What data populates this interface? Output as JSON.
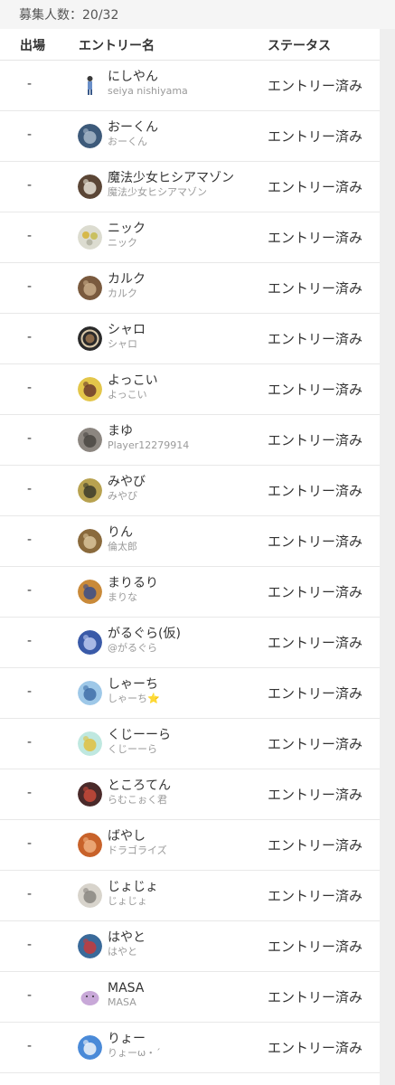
{
  "recruit": {
    "label": "募集人数：20/32"
  },
  "table": {
    "headers": {
      "appear": "出場",
      "name": "エントリー名",
      "status": "ステータス"
    },
    "rows": [
      {
        "appear": "-",
        "name": "にしやん",
        "sub": "seiya nishiyama",
        "status": "エントリー済み",
        "avatar": {
          "type": "figure",
          "bg": "#ffffff",
          "fg": "#6a8fc9"
        }
      },
      {
        "appear": "-",
        "name": "おーくん",
        "sub": "おーくん",
        "status": "エントリー済み",
        "avatar": {
          "type": "circle",
          "bg": "#3d5a7a",
          "fg": "#a7b8c9"
        }
      },
      {
        "appear": "-",
        "name": "魔法少女ヒシアマゾン",
        "sub": "魔法少女ヒシアマゾン",
        "status": "エントリー済み",
        "avatar": {
          "type": "circle",
          "bg": "#5b4636",
          "fg": "#e8e2d6"
        }
      },
      {
        "appear": "-",
        "name": "ニック",
        "sub": "ニック",
        "status": "エントリー済み",
        "avatar": {
          "type": "dots",
          "bg": "#dcdcd0",
          "fg": "#d6b84a"
        }
      },
      {
        "appear": "-",
        "name": "カルク",
        "sub": "カルク",
        "status": "エントリー済み",
        "avatar": {
          "type": "circle",
          "bg": "#7a5a3e",
          "fg": "#c9ad8a"
        }
      },
      {
        "appear": "-",
        "name": "シャロ",
        "sub": "シャロ",
        "status": "エントリー済み",
        "avatar": {
          "type": "ring",
          "bg": "#2a2a2a",
          "fg": "#d8c7a8"
        }
      },
      {
        "appear": "-",
        "name": "よっこい",
        "sub": "よっこい",
        "status": "エントリー済み",
        "avatar": {
          "type": "circle",
          "bg": "#e3c64a",
          "fg": "#6b3a2a"
        }
      },
      {
        "appear": "-",
        "name": "まゆ",
        "sub": "Player12279914",
        "status": "エントリー済み",
        "avatar": {
          "type": "circle",
          "bg": "#8c8680",
          "fg": "#4a4642"
        }
      },
      {
        "appear": "-",
        "name": "みやび",
        "sub": "みやび",
        "status": "エントリー済み",
        "avatar": {
          "type": "circle",
          "bg": "#b8a250",
          "fg": "#3b3b2a"
        }
      },
      {
        "appear": "-",
        "name": "りん",
        "sub": "倫太郎",
        "status": "エントリー済み",
        "avatar": {
          "type": "circle",
          "bg": "#8a6a3c",
          "fg": "#d8c39a"
        }
      },
      {
        "appear": "-",
        "name": "まりるり",
        "sub": "まりな",
        "status": "エントリー済み",
        "avatar": {
          "type": "circle",
          "bg": "#c98a3a",
          "fg": "#3a4d8a"
        }
      },
      {
        "appear": "-",
        "name": "がるぐら(仮)",
        "sub": "@がるぐら",
        "status": "エントリー済み",
        "avatar": {
          "type": "circle",
          "bg": "#3a5aa8",
          "fg": "#bcc9f0"
        }
      },
      {
        "appear": "-",
        "name": "しゃーち",
        "sub": "しゃーち⭐️",
        "status": "エントリー済み",
        "avatar": {
          "type": "circle",
          "bg": "#9ec8e8",
          "fg": "#3f6fa8"
        }
      },
      {
        "appear": "-",
        "name": "くじーーら",
        "sub": "くじーーら",
        "status": "エントリー済み",
        "avatar": {
          "type": "circle",
          "bg": "#bfe8e0",
          "fg": "#e0c040"
        }
      },
      {
        "appear": "-",
        "name": "ところてん",
        "sub": "らむこぉく君",
        "status": "エントリー済み",
        "avatar": {
          "type": "circle",
          "bg": "#4a2a2a",
          "fg": "#c84a3a"
        }
      },
      {
        "appear": "-",
        "name": "ばやし",
        "sub": "ドラゴライズ",
        "status": "エントリー済み",
        "avatar": {
          "type": "circle",
          "bg": "#c8622a",
          "fg": "#f0b080"
        }
      },
      {
        "appear": "-",
        "name": "じょじょ",
        "sub": "じょじょ",
        "status": "エントリー済み",
        "avatar": {
          "type": "circle",
          "bg": "#d8d4cc",
          "fg": "#8a8680"
        }
      },
      {
        "appear": "-",
        "name": "はやと",
        "sub": "はやと",
        "status": "エントリー済み",
        "avatar": {
          "type": "circle",
          "bg": "#3a6a9a",
          "fg": "#c83a3a"
        }
      },
      {
        "appear": "-",
        "name": "MASA",
        "sub": "MASA",
        "status": "エントリー済み",
        "avatar": {
          "type": "blob",
          "bg": "#ffffff",
          "fg": "#c8a8d8"
        }
      },
      {
        "appear": "-",
        "name": "りょー",
        "sub": "りょーω・´",
        "status": "エントリー済み",
        "avatar": {
          "type": "circle",
          "bg": "#4a8ad8",
          "fg": "#f0f4fa"
        }
      }
    ]
  }
}
